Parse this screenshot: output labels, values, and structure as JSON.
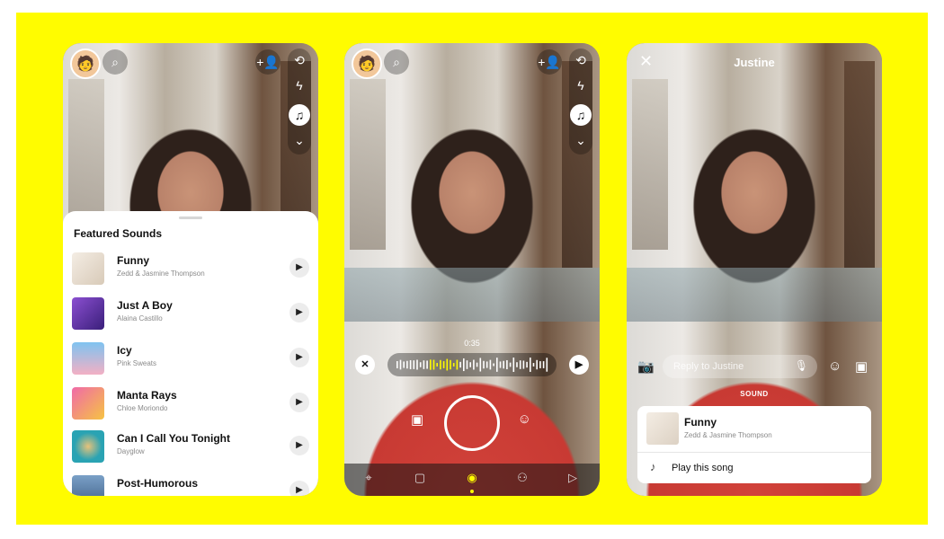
{
  "colors": {
    "background": "#FFFC00",
    "accent": "#FFFC00",
    "shirt": "#c83a33"
  },
  "phone1": {
    "icons": [
      "bitmoji-avatar",
      "search-icon",
      "add-friend-icon",
      "flip-camera-icon",
      "flash-off-icon",
      "music-icon",
      "chevron-down-icon"
    ],
    "sheet_title": "Featured Sounds",
    "songs": [
      {
        "title": "Funny",
        "artist": "Zedd & Jasmine Thompson"
      },
      {
        "title": "Just A Boy",
        "artist": "Alaina Castillo"
      },
      {
        "title": "Icy",
        "artist": "Pink Sweats"
      },
      {
        "title": "Manta Rays",
        "artist": "Chloe Moriondo"
      },
      {
        "title": "Can I Call You Tonight",
        "artist": "Dayglow"
      },
      {
        "title": "Post-Humorous",
        "artist": ""
      }
    ],
    "play_glyph": "▶"
  },
  "phone2": {
    "time": "0:35",
    "close_glyph": "✕",
    "play_glyph": "▶",
    "tabs": [
      "map",
      "chat",
      "camera",
      "friends",
      "discover"
    ],
    "active_tab": "camera"
  },
  "phone3": {
    "title": "Justine",
    "close_glyph": "✕",
    "reply_placeholder": "Reply to Justine",
    "sound_label": "SOUND",
    "song": {
      "title": "Funny",
      "artist": "Zedd & Jasmine Thompson"
    },
    "play_song_label": "Play this song"
  }
}
